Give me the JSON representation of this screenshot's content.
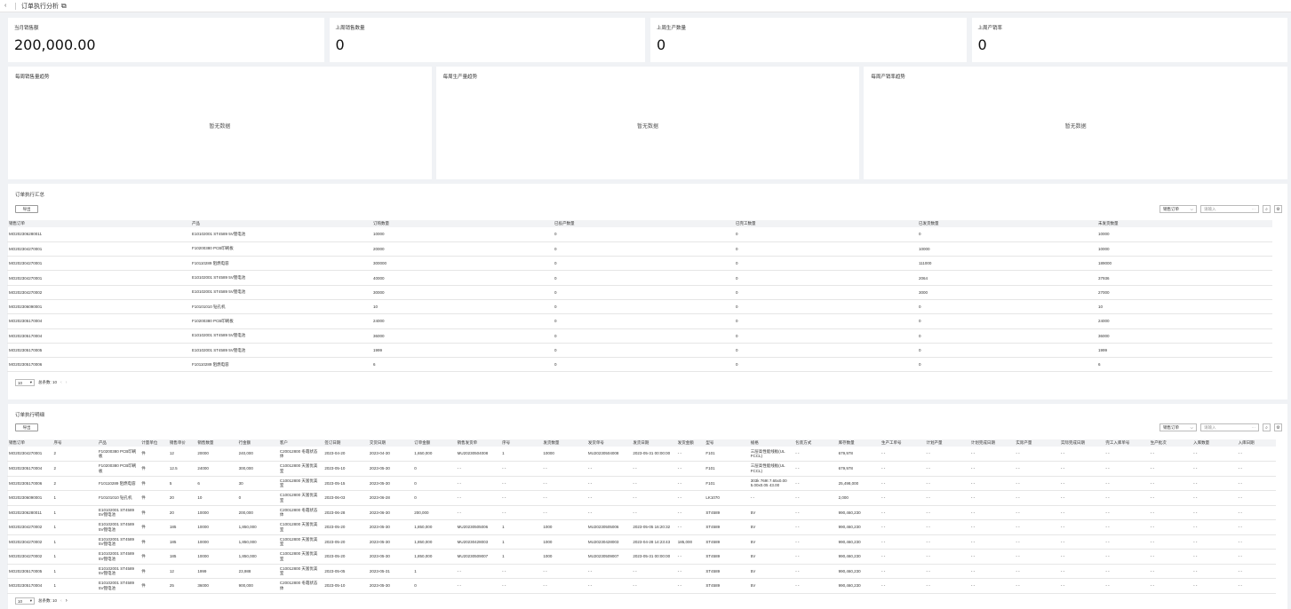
{
  "topbar": {
    "back": "‹",
    "title": "订单执行分析",
    "ext": "⧉"
  },
  "stats": [
    {
      "label": "当月销售额",
      "value": "200,000.00"
    },
    {
      "label": "上周销售数量",
      "value": "0"
    },
    {
      "label": "上周生产数量",
      "value": "0"
    },
    {
      "label": "上周产销率",
      "value": "0"
    }
  ],
  "trends": [
    {
      "title": "每周销售量趋势",
      "empty": "暂无数据"
    },
    {
      "title": "每周生产量趋势",
      "empty": "暂无数据"
    },
    {
      "title": "每周产销率趋势",
      "empty": "暂无数据"
    }
  ],
  "summary": {
    "title": "订单执行汇总",
    "export": "导出",
    "select": "销售订单",
    "search_placeholder": "请输入",
    "headers": [
      "销售订单",
      "产品",
      "订购数量",
      "已投产数量",
      "已完工数量",
      "已发货数量",
      "未发货数量"
    ],
    "rows": [
      [
        "MO202306280011",
        "E10102001 ST4589 5V锂电池",
        "10000",
        "0",
        "0",
        "0",
        "10000"
      ],
      [
        "MO202304270001",
        "F10200380 PCB印刷板",
        "20000",
        "0",
        "0",
        "10000",
        "10000"
      ],
      [
        "MO202304270001",
        "F10110289 阻燃电容",
        "300000",
        "0",
        "0",
        "111000",
        "189000"
      ],
      [
        "MO202304270001",
        "E10102001 ST4589 5V锂电池",
        "40000",
        "0",
        "0",
        "2064",
        "37936"
      ],
      [
        "MO202304270002",
        "E10102001 ST4589 5V锂电池",
        "30000",
        "0",
        "0",
        "3000",
        "27000"
      ],
      [
        "MO202306090001",
        "F10101010 钻孔机",
        "10",
        "0",
        "0",
        "0",
        "10"
      ],
      [
        "MO202305170004",
        "F10200380 PCB印刷板",
        "24000",
        "0",
        "0",
        "0",
        "24000"
      ],
      [
        "MO202305170004",
        "E10102001 ST4589 5V锂电池",
        "36000",
        "0",
        "0",
        "0",
        "36000"
      ],
      [
        "MO202305170005",
        "E10102001 ST4589 5V锂电池",
        "1999",
        "0",
        "0",
        "0",
        "1999"
      ],
      [
        "MO202305170006",
        "F10110289 阻燃电容",
        "6",
        "0",
        "0",
        "0",
        "6"
      ]
    ],
    "page_size": "10",
    "total": "总条数: 10"
  },
  "detail": {
    "title": "订单执行明细",
    "export": "导出",
    "select": "销售订单",
    "search_placeholder": "请输入",
    "headers": [
      "销售订单",
      "序号",
      "产品",
      "计量单位",
      "销售单价",
      "销售数量",
      "行金额",
      "客户",
      "签订日期",
      "交货日期",
      "订单金额",
      "销售发货单",
      "序号",
      "发货数量",
      "发货单号",
      "发货日期",
      "发货金额",
      "型号",
      "规格",
      "包装方式",
      "库存数量",
      "生产工单号",
      "计划产量",
      "计划完成日期",
      "实际产量",
      "实际完成日期",
      "完工入库单号",
      "生产批次",
      "入库数量",
      "入库日期"
    ],
    "rows": [
      [
        "MO202304270001",
        "2",
        "F10200380 PCB印刷板",
        "件",
        "12",
        "20000",
        "240,000",
        "C20012800 冬霞状态 体",
        "2023-04-20",
        "2023-04-30",
        "1,650,000",
        "MU20230504008",
        "1",
        "10000",
        "MU20230504008",
        "2023-05-31 00:00:00",
        "- -",
        "F101",
        "三层高性能线板(UL FCCL)",
        "- -",
        "679,978",
        "- -",
        "- -",
        "- -",
        "- -",
        "- -",
        "- -",
        "- -",
        "- -",
        "- -"
      ],
      [
        "MO202305170004",
        "2",
        "F10200380 PCB印刷板",
        "件",
        "12.5",
        "24000",
        "300,000",
        "C10012800 天富优美 室",
        "2023-05-10",
        "2023-05-30",
        "0",
        "- -",
        "- -",
        "- -",
        "- -",
        "- -",
        "- -",
        "F101",
        "三层高性能线板(UL FCCL)",
        "- -",
        "679,978",
        "- -",
        "- -",
        "- -",
        "- -",
        "- -",
        "- -",
        "- -",
        "- -",
        "- -"
      ],
      [
        "MO202305170006",
        "2",
        "F10110289 阻燃电容",
        "件",
        "5",
        "6",
        "30",
        "C10012800 天富优美 室",
        "2023-05-15",
        "2023-05-30",
        "0",
        "- -",
        "- -",
        "- -",
        "- -",
        "- -",
        "- -",
        "F101",
        "303k 769t 7.65x0.00 5.00x0.05 43.00",
        "- -",
        "25,498,000",
        "- -",
        "- -",
        "- -",
        "- -",
        "- -",
        "- -",
        "- -",
        "- -",
        "- -"
      ],
      [
        "MO202306090001",
        "1",
        "F10101010 钻孔机",
        "件",
        "20",
        "10",
        "0",
        "C10012800 天富优美 室",
        "2023-06-03",
        "2023-06-28",
        "0",
        "- -",
        "- -",
        "- -",
        "- -",
        "- -",
        "- -",
        "LK1070",
        "- -",
        "- -",
        "2,000",
        "- -",
        "- -",
        "- -",
        "- -",
        "- -",
        "- -",
        "- -",
        "- -",
        "- -"
      ],
      [
        "MO202306280011",
        "1",
        "E10102001 ST4589 5V锂电池",
        "件",
        "20",
        "10000",
        "200,000",
        "C20012800 冬霞状态 体",
        "2023-06-28",
        "2023-06-30",
        "200,000",
        "- -",
        "- -",
        "- -",
        "- -",
        "- -",
        "- -",
        "ST4589",
        "5V",
        "- -",
        "990,460,230",
        "- -",
        "- -",
        "- -",
        "- -",
        "- -",
        "- -",
        "- -",
        "- -",
        "- -"
      ],
      [
        "MO202304270002",
        "1",
        "E10102001 ST4589 5V锂电池",
        "件",
        "185",
        "10000",
        "1,850,000",
        "C10012800 天富优美 室",
        "2023-05-20",
        "2023-05-30",
        "1,850,000",
        "MU20230505006",
        "1",
        "1000",
        "MU20230505006",
        "2023-05-05 16:20:32",
        "- -",
        "ST4589",
        "5V",
        "- -",
        "990,460,230",
        "- -",
        "- -",
        "- -",
        "- -",
        "- -",
        "- -",
        "- -",
        "- -",
        "- -"
      ],
      [
        "MO202304270002",
        "1",
        "E10102001 ST4589 5V锂电池",
        "件",
        "185",
        "10000",
        "1,850,000",
        "C10012800 天富优美 室",
        "2023-05-20",
        "2023-05-30",
        "1,850,000",
        "MU20230428003",
        "1",
        "1000",
        "MU20230428003",
        "2023-04-28 14:23:43",
        "185,000",
        "ST4589",
        "5V",
        "- -",
        "990,460,230",
        "- -",
        "- -",
        "- -",
        "- -",
        "- -",
        "- -",
        "- -",
        "- -",
        "- -"
      ],
      [
        "MO202304270002",
        "1",
        "E10102001 ST4589 5V锂电池",
        "件",
        "185",
        "10000",
        "1,850,000",
        "C10012800 天富优美 室",
        "2023-05-20",
        "2023-05-30",
        "1,850,000",
        "MU20230509007",
        "1",
        "1000",
        "MU20230509007",
        "2023-05-31 00:00:00",
        "- -",
        "ST4589",
        "5V",
        "- -",
        "990,460,230",
        "- -",
        "- -",
        "- -",
        "- -",
        "- -",
        "- -",
        "- -",
        "- -",
        "- -"
      ],
      [
        "MO202305170005",
        "1",
        "E10102001 ST4589 5V锂电池",
        "件",
        "12",
        "1999",
        "23,988",
        "C10012800 天富优美 室",
        "2023-05-05",
        "2023-05-31",
        "1",
        "- -",
        "- -",
        "- -",
        "- -",
        "- -",
        "- -",
        "ST4589",
        "5V",
        "- -",
        "990,460,230",
        "- -",
        "- -",
        "- -",
        "- -",
        "- -",
        "- -",
        "- -",
        "- -",
        "- -"
      ],
      [
        "MO202305170004",
        "1",
        "E10102001 ST4589 5V锂电池",
        "件",
        "25",
        "36000",
        "900,000",
        "C20012800 冬霞状态 体",
        "2023-05-10",
        "2023-05-30",
        "0",
        "- -",
        "- -",
        "- -",
        "- -",
        "- -",
        "- -",
        "ST4589",
        "5V",
        "- -",
        "990,460,230",
        "- -",
        "- -",
        "- -",
        "- -",
        "- -",
        "- -",
        "- -",
        "- -",
        "- -"
      ]
    ],
    "page_size": "10",
    "total": "总条数: 10",
    "next": "›"
  }
}
